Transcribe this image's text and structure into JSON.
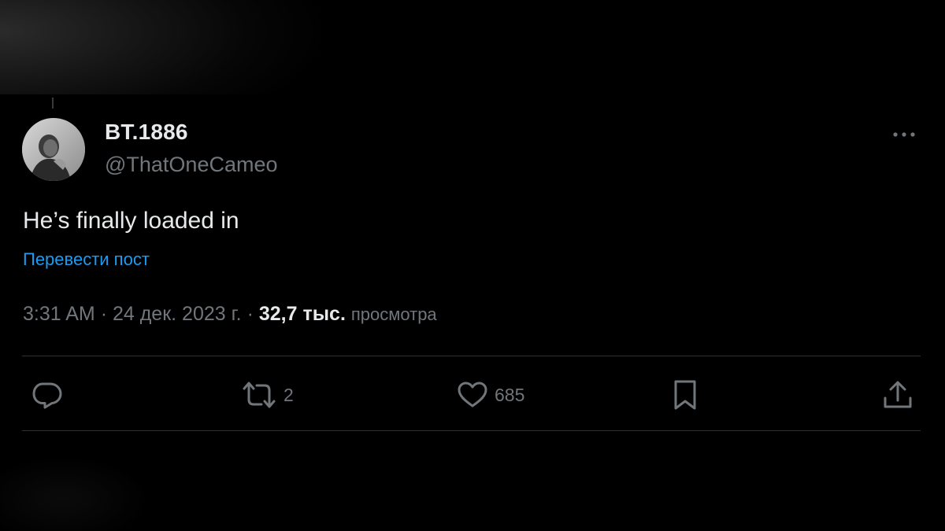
{
  "tweet": {
    "author": {
      "display_name": "BT.1886",
      "handle": "@ThatOneCameo"
    },
    "text": "He’s finally loaded in",
    "translate_label": "Перевести пост",
    "meta": {
      "time": "3:31 AM",
      "separator": "·",
      "date": "24 дек. 2023 г.",
      "views_count": "32,7 тыс.",
      "views_label": "просмотра"
    },
    "actions": {
      "reply_count": "",
      "retweet_count": "2",
      "like_count": "685"
    }
  },
  "icons": {
    "more": "more-horizontal-icon",
    "reply": "reply-bubble-icon",
    "retweet": "retweet-icon",
    "like": "heart-icon",
    "bookmark": "bookmark-icon",
    "share": "share-upload-icon"
  },
  "colors": {
    "background": "#000000",
    "primary_text": "#e7e9ea",
    "secondary_text": "#71767b",
    "link": "#1d9bf0",
    "divider": "#2f3336"
  }
}
